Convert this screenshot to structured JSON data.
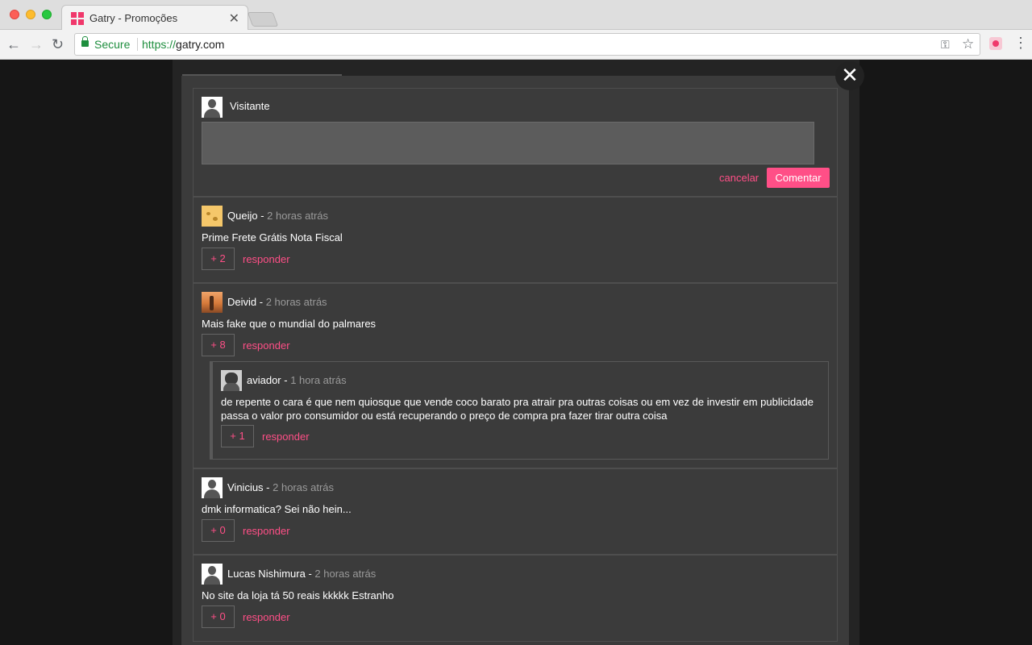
{
  "browser": {
    "tab_title": "Gatry - Promoções",
    "secure_label": "Secure",
    "url_scheme": "https://",
    "url_host": "gatry.com"
  },
  "composer": {
    "username": "Visitante",
    "cancel_label": "cancelar",
    "submit_label": "Comentar"
  },
  "comments": [
    {
      "author": "Queijo",
      "time": "2 horas atrás",
      "text": "Prime Frete Grátis Nota Fiscal",
      "votes": "+ 2",
      "reply_label": "responder"
    },
    {
      "author": "Deivid",
      "time": "2 horas atrás",
      "text": "Mais fake que o mundial do palmares",
      "votes": "+ 8",
      "reply_label": "responder",
      "reply": {
        "author": "aviador",
        "time": "1 hora atrás",
        "text_line1": "de repente o cara é que nem quiosque que vende coco barato pra atrair pra outras coisas ou em vez de investir em publicidade",
        "text_line2": "passa o valor pro consumidor ou está recuperando o preço de compra pra fazer tirar outra coisa",
        "votes": "+ 1",
        "reply_label": "responder"
      }
    },
    {
      "author": "Vinicius",
      "time": "2 horas atrás",
      "text": "dmk informatica? Sei não hein...",
      "votes": "+ 0",
      "reply_label": "responder"
    },
    {
      "author": "Lucas Nishimura",
      "time": "2 horas atrás",
      "text": "No site da loja tá 50 reais kkkkk Estranho",
      "votes": "+ 0",
      "reply_label": "responder"
    }
  ],
  "colors": {
    "accent": "#ff4f87",
    "modal_bg": "#3b3b3b",
    "page_bg": "#161616"
  }
}
